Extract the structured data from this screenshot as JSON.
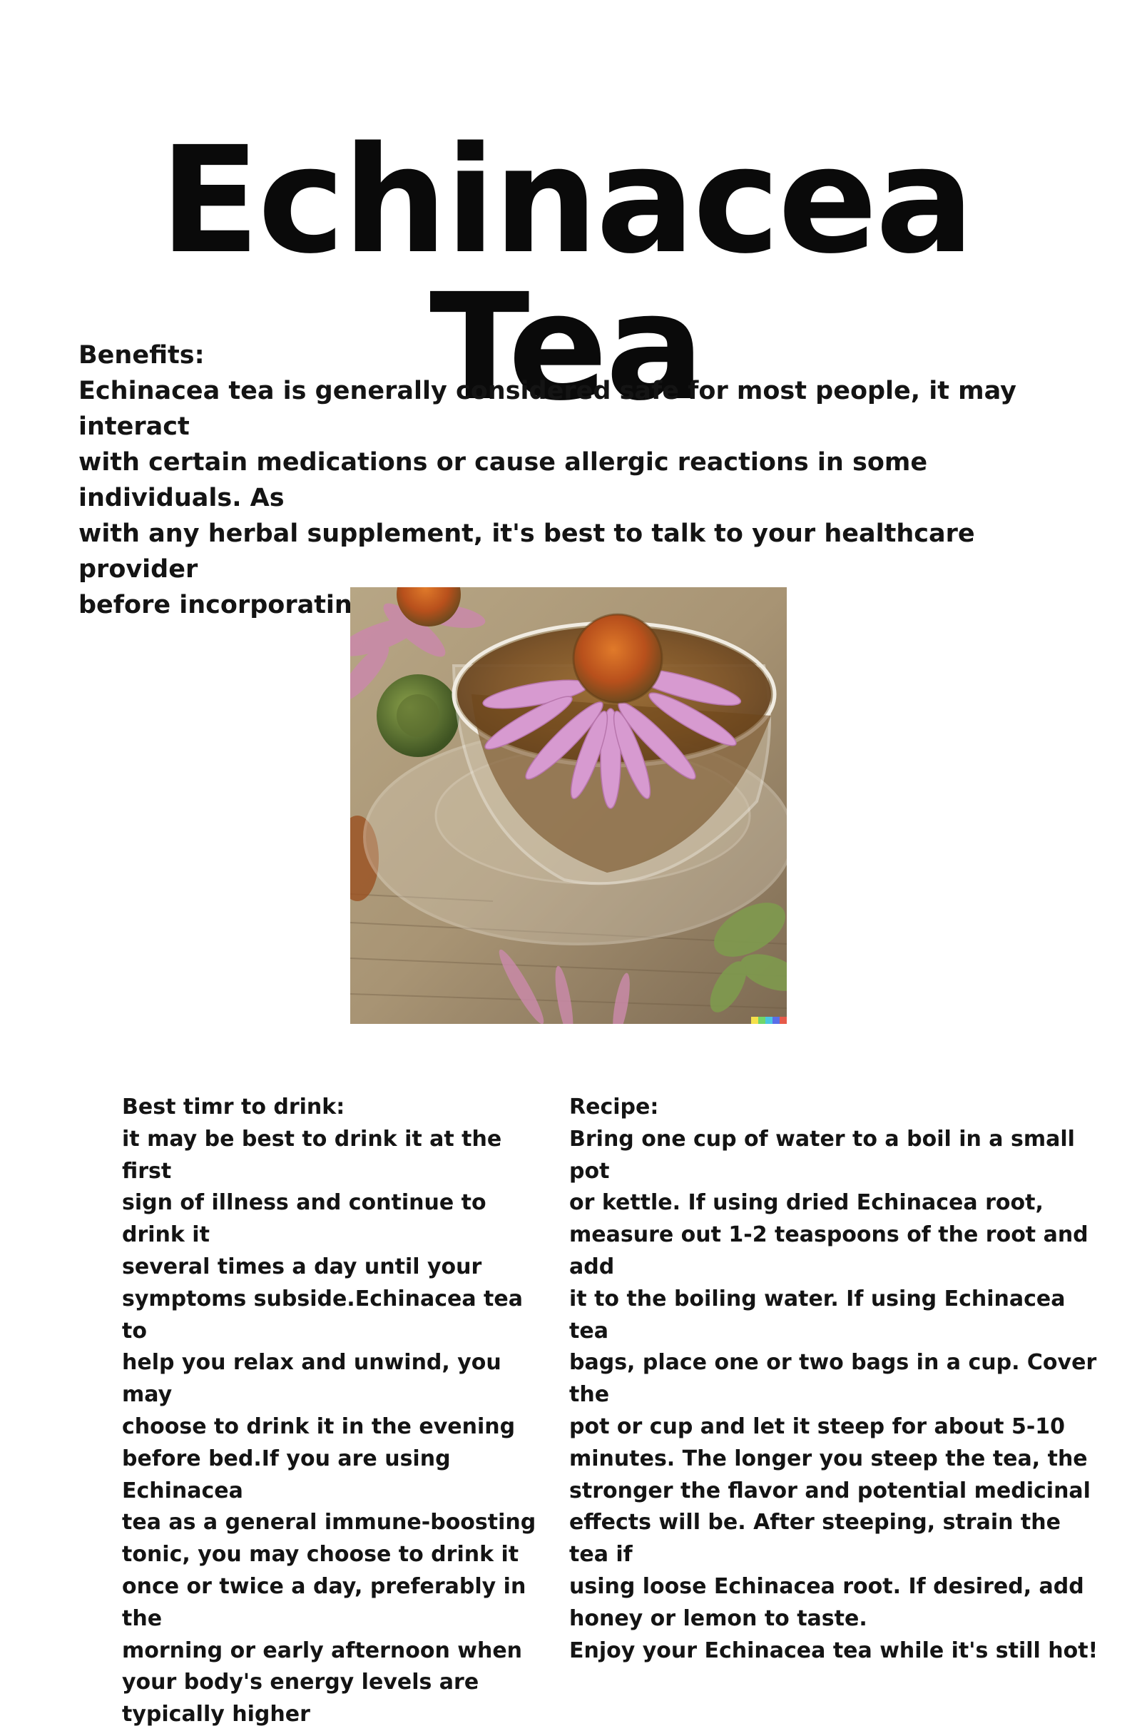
{
  "title": "Echinacea Tea",
  "benefits": {
    "label": "Benefits:",
    "text": "Echinacea tea is generally considered safe for most people, it may interact\nwith certain medications or cause allergic reactions in some individuals. As\nwith any herbal supplement, it's best to talk to your healthcare provider\nbefore incorporating Echinacea tea into your diet."
  },
  "best_time": {
    "label": "Best timr to drink:",
    "text": "it may be best to drink it at the first\nsign of illness and continue to drink it\nseveral times a day until your\nsymptoms subside.Echinacea tea to\nhelp you relax and unwind, you may\nchoose to drink it in the evening\nbefore bed.If you are using Echinacea\ntea as a general immune-boosting\ntonic, you may choose to drink it\nonce or twice a day, preferably in the\nmorning or early afternoon when\nyour body's energy levels are\ntypically higher"
  },
  "recipe": {
    "label": "Recipe:",
    "text": "Bring one cup of water to a boil in a small pot\nor kettle. If using dried Echinacea root,\nmeasure out 1-2 teaspoons of the root and add\nit to the boiling water. If using Echinacea tea\nbags, place one or two bags in a cup. Cover the\npot or cup and let it steep for about 5-10\nminutes. The longer you steep the tea, the\nstronger the flavor and potential medicinal\neffects will be. After steeping, strain the tea if\nusing loose Echinacea root. If desired, add\nhoney or lemon to taste.\nEnjoy your Echinacea tea while it's still hot!"
  }
}
